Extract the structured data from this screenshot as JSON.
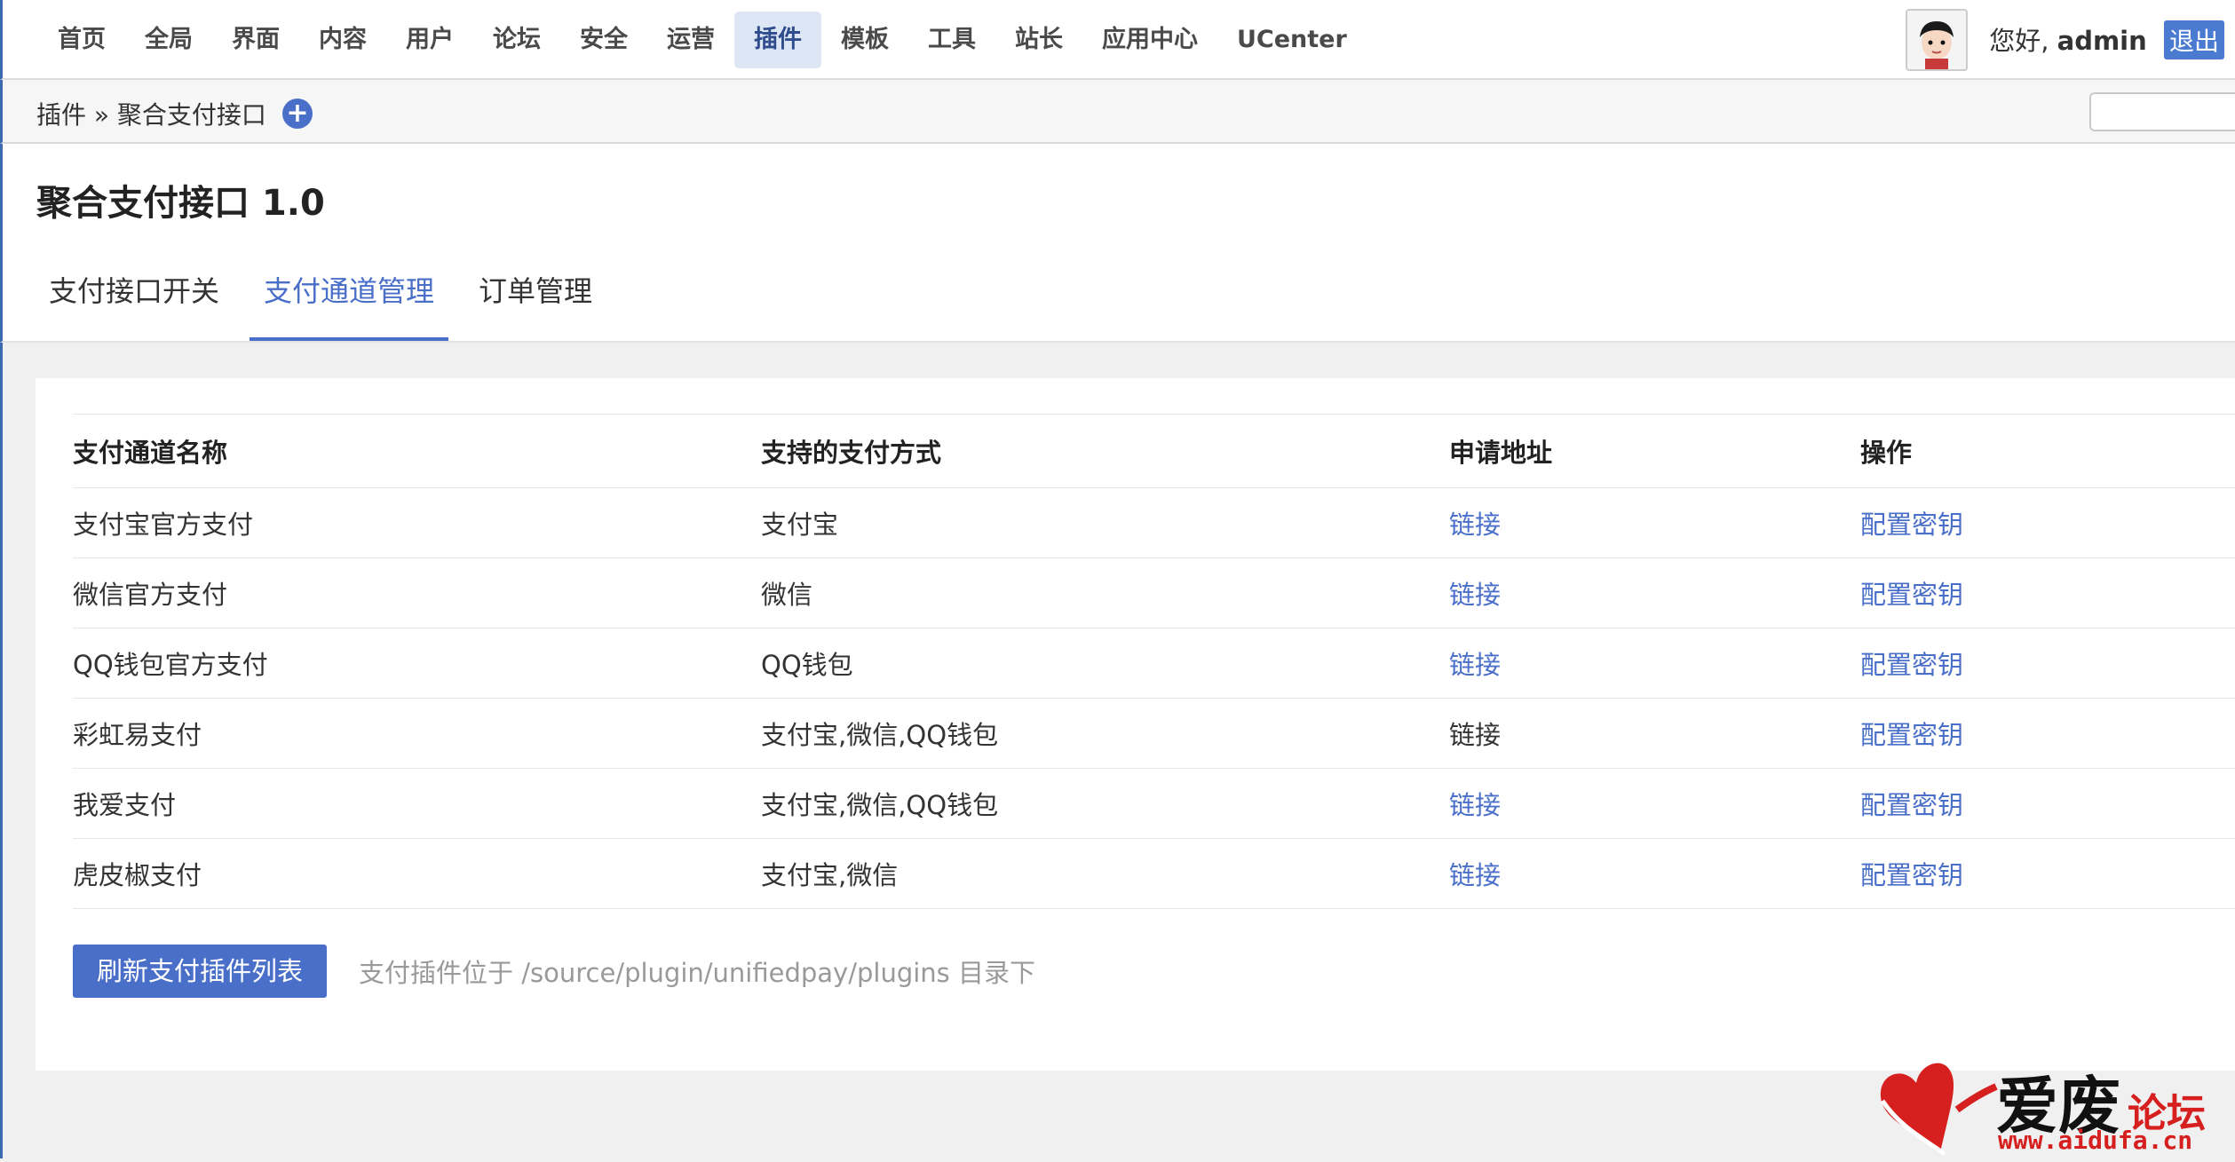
{
  "nav": {
    "items": [
      "首页",
      "全局",
      "界面",
      "内容",
      "用户",
      "论坛",
      "安全",
      "运营",
      "插件",
      "模板",
      "工具",
      "站长",
      "应用中心",
      "UCenter"
    ],
    "active_index": 8
  },
  "user": {
    "greeting_prefix": "您好,",
    "username": "admin",
    "logout_label": "退出"
  },
  "breadcrumb": {
    "text": "插件 » 聚合支付接口"
  },
  "page": {
    "title": "聚合支付接口 1.0"
  },
  "tabs": [
    {
      "label": "支付接口开关",
      "active": false
    },
    {
      "label": "支付通道管理",
      "active": true
    },
    {
      "label": "订单管理",
      "active": false
    }
  ],
  "table": {
    "headers": [
      "支付通道名称",
      "支持的支付方式",
      "申请地址",
      "操作"
    ],
    "rows": [
      {
        "name": "支付宝官方支付",
        "methods": "支付宝",
        "apply": "链接",
        "apply_is_link": true,
        "action": "配置密钥"
      },
      {
        "name": "微信官方支付",
        "methods": "微信",
        "apply": "链接",
        "apply_is_link": true,
        "action": "配置密钥"
      },
      {
        "name": "QQ钱包官方支付",
        "methods": "QQ钱包",
        "apply": "链接",
        "apply_is_link": true,
        "action": "配置密钥"
      },
      {
        "name": "彩虹易支付",
        "methods": "支付宝,微信,QQ钱包",
        "apply": "链接",
        "apply_is_link": false,
        "action": "配置密钥"
      },
      {
        "name": "我爱支付",
        "methods": "支付宝,微信,QQ钱包",
        "apply": "链接",
        "apply_is_link": true,
        "action": "配置密钥"
      },
      {
        "name": "虎皮椒支付",
        "methods": "支付宝,微信",
        "apply": "链接",
        "apply_is_link": true,
        "action": "配置密钥"
      }
    ]
  },
  "footer": {
    "refresh_label": "刷新支付插件列表",
    "hint": "支付插件位于 /source/plugin/unifiedpay/plugins 目录下"
  },
  "watermark": {
    "title": "爱废",
    "subtitle": "论坛",
    "url": "www.aidufa.cn"
  },
  "colors": {
    "accent": "#4a6fc9",
    "nav_active_bg": "#dde6f4",
    "watermark_red": "#d6201f"
  }
}
